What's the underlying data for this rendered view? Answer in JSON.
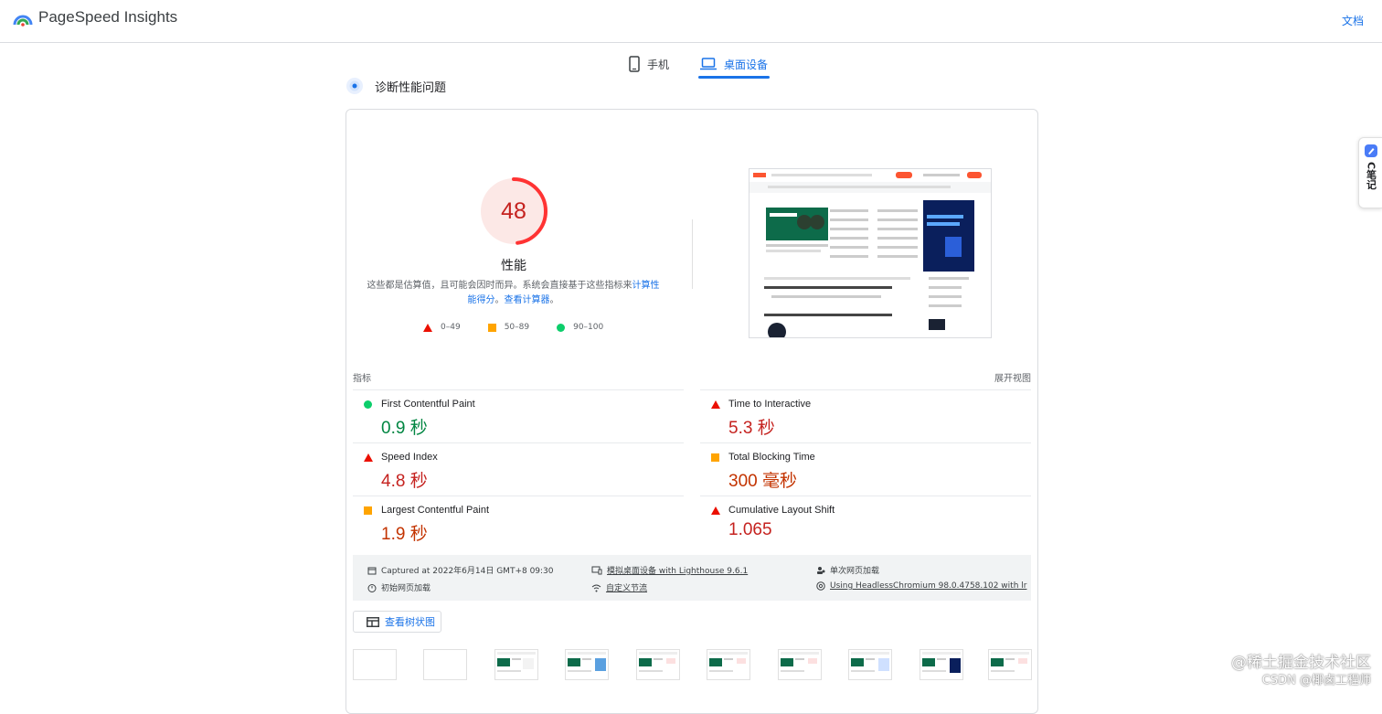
{
  "header": {
    "app_title": "PageSpeed Insights",
    "docs_link": "文档"
  },
  "tabs": [
    {
      "label": "手机",
      "active": false,
      "icon": "phone-icon"
    },
    {
      "label": "桌面设备",
      "active": true,
      "icon": "laptop-icon"
    }
  ],
  "section_title": "诊断性能问题",
  "performance": {
    "score": "48",
    "score_value": 48,
    "label": "性能",
    "desc_prefix": "这些都是估算值，且可能会因时而异。系统会直接基于这些指标来",
    "desc_link1": "计算性能得分",
    "desc_mid": "。",
    "desc_link2": "查看计算器",
    "desc_suffix": "。"
  },
  "legend": [
    {
      "shape": "triangle",
      "label": "0–49"
    },
    {
      "shape": "square",
      "label": "50–89"
    },
    {
      "shape": "circle",
      "label": "90–100"
    }
  ],
  "metrics_header": {
    "title": "指标",
    "expand": "展开视图"
  },
  "metrics": [
    {
      "name": "First Contentful Paint",
      "value": "0.9 秒",
      "status": "good"
    },
    {
      "name": "Time to Interactive",
      "value": "5.3 秒",
      "status": "poor"
    },
    {
      "name": "Speed Index",
      "value": "4.8 秒",
      "status": "poor"
    },
    {
      "name": "Total Blocking Time",
      "value": "300 毫秒",
      "status": "average"
    },
    {
      "name": "Largest Contentful Paint",
      "value": "1.9 秒",
      "status": "average"
    },
    {
      "name": "Cumulative Layout Shift",
      "value": "1.065",
      "status": "poor"
    }
  ],
  "info": {
    "captured": "Captured at 2022年6月14日 GMT+8 09:30",
    "emulated": "模拟桌面设备 with Lighthouse 9.6.1",
    "single_load": "单次网页加载",
    "initial_load": "初始网页加载",
    "throttling": "自定义节流",
    "browser": "Using HeadlessChromium 98.0.4758.102 with lr"
  },
  "tree_button": "查看树状图",
  "side_widget": "C笔记",
  "watermark": {
    "line1": "@稀土掘金技术社区",
    "line2": "CSDN @椰卤工程师"
  },
  "colors": {
    "good": "#0cce6b",
    "average": "#ffa400",
    "poor": "#eb0f00",
    "good_text": "#018642",
    "average_text": "#c33300",
    "poor_text": "#c5221f",
    "accent": "#1a73e8"
  }
}
